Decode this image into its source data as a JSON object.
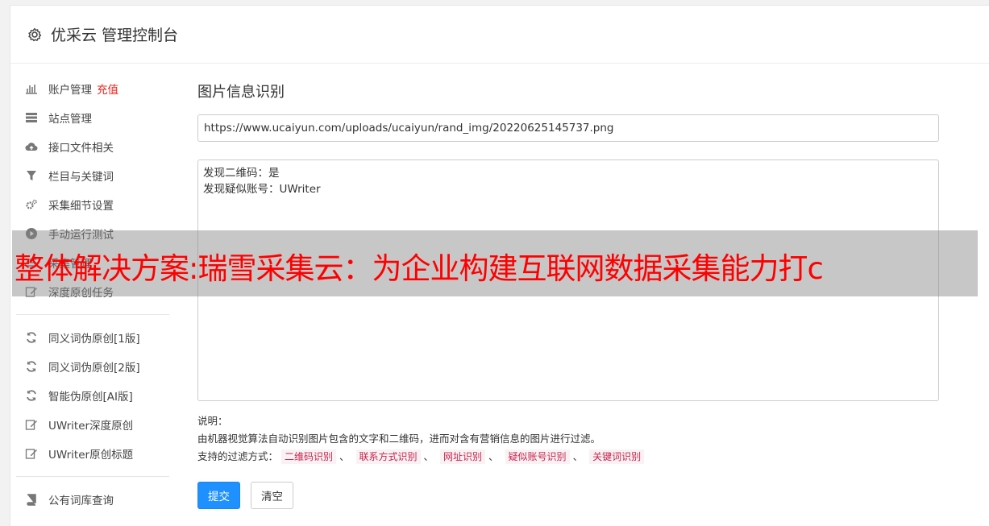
{
  "header": {
    "title": "优采云 管理控制台",
    "icon": "gear-icon"
  },
  "sidebar": {
    "group1": [
      {
        "label": "账户管理",
        "extra": "充值",
        "icon": "bar-chart-icon"
      },
      {
        "label": "站点管理",
        "icon": "server-icon"
      },
      {
        "label": "接口文件相关",
        "icon": "cloud-upload-icon"
      },
      {
        "label": "栏目与关键词",
        "icon": "filter-icon"
      },
      {
        "label": "采集细节设置",
        "icon": "cogs-icon"
      },
      {
        "label": "手动运行测试",
        "icon": "play-circle-icon"
      },
      {
        "label": "采集管理",
        "icon": "list-icon"
      },
      {
        "label": "深度原创任务",
        "icon": "edit-icon"
      }
    ],
    "group2": [
      {
        "label": "同义词伪原创[1版]",
        "icon": "refresh-icon"
      },
      {
        "label": "同义词伪原创[2版]",
        "icon": "refresh-icon"
      },
      {
        "label": "智能伪原创[AI版]",
        "icon": "refresh-icon"
      },
      {
        "label": "UWriter深度原创",
        "icon": "edit-icon"
      },
      {
        "label": "UWriter原创标题",
        "icon": "edit-icon"
      }
    ],
    "group3": [
      {
        "label": "公有词库查询",
        "icon": "book-icon"
      }
    ]
  },
  "main": {
    "title": "图片信息识别",
    "url_value": "https://www.ucaiyun.com/uploads/ucaiyun/rand_img/20220625145737.png",
    "result_text": "发现二维码：是\n发现疑似账号：UWriter",
    "notes_title": "说明：",
    "notes_desc": "由机器视觉算法自动识别图片包含的文字和二维码，进而对含有营销信息的图片进行过滤。",
    "filters_label": "支持的过滤方式：",
    "filters": [
      "二维码识别",
      "联系方式识别",
      "网址识别",
      "疑似账号识别",
      "关键词识别"
    ],
    "filter_sep": "、",
    "submit_label": "提交",
    "clear_label": "清空"
  },
  "overlay": {
    "text": "整体解决方案:瑞雪采集云：为企业构建互联网数据采集能力打c"
  },
  "colors": {
    "primary": "#1e90ff",
    "recharge": "#e6221c",
    "tag": "#c7254e",
    "overlay_text": "#ff0000"
  }
}
